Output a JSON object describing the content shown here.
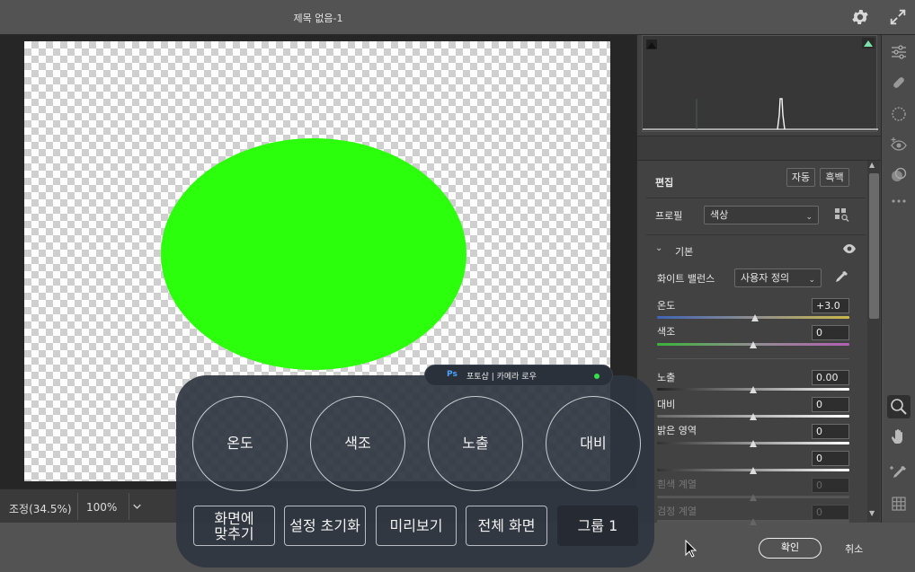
{
  "window": {
    "title": "제목 없음-1"
  },
  "status": {
    "zoom_label": "조정(34.5%)",
    "zoom_value": "100%"
  },
  "panel": {
    "edit_label": "편집",
    "auto_button": "자동",
    "bw_button": "흑백",
    "profile_label": "프로필",
    "profile_value": "색상",
    "basic_label": "기본",
    "wb_label": "화이트 밸런스",
    "wb_value": "사용자 정의",
    "temp_label": "온도",
    "temp_value": "+3.0",
    "tint_label": "색조",
    "tint_value": "0",
    "exposure_label": "노출",
    "exposure_value": "0.00",
    "contrast_label": "대비",
    "contrast_value": "0",
    "highlights_label": "밝은 영역",
    "highlights_value": "0",
    "shadows_value": "0",
    "whites_label": "흰색 계열",
    "whites_value": "0",
    "blacks_label": "검정 계열",
    "blacks_value": "0"
  },
  "sliders": {
    "temp": 0.51,
    "tint": 0.5,
    "exposure": 0.5,
    "contrast": 0.5,
    "highlights": 0.5,
    "shadows": 0.5,
    "whites": 0.5,
    "blacks": 0.5
  },
  "footer": {
    "ok_label": "확인",
    "cancel_label": "취소"
  },
  "overlay": {
    "pill_logo": "Ps",
    "pill_text": "포토샵 | 카메라 로우",
    "dials": [
      "온도",
      "색조",
      "노출",
      "대비"
    ],
    "buttons": [
      "화면에\n맞추기",
      "설정 초기화",
      "미리보기",
      "전체 화면",
      "그룹 1"
    ]
  },
  "colors": {
    "canvas_blob": "#2cff0c",
    "overlay_bg": "#2f3640",
    "pill_dot": "#35e04a",
    "ps_blue": "#4aa3ff"
  },
  "icons": [
    "gear-icon",
    "expand-icon",
    "sliders-icon",
    "healing-brush-icon",
    "mask-icon",
    "red-eye-icon",
    "presets-icon",
    "more-icon",
    "zoom-icon",
    "hand-icon",
    "color-sampler-icon",
    "grid-icon"
  ]
}
